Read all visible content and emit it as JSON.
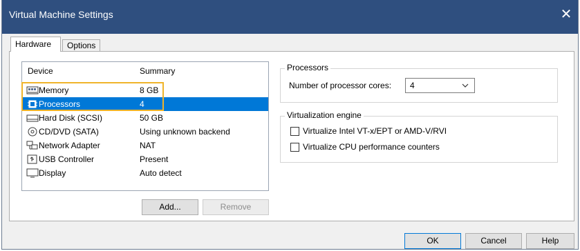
{
  "window": {
    "title": "Virtual Machine Settings",
    "close_glyph": "✕"
  },
  "tabs": [
    {
      "label": "Hardware"
    },
    {
      "label": "Options"
    }
  ],
  "device_list": {
    "headers": {
      "device": "Device",
      "summary": "Summary"
    },
    "rows": [
      {
        "name": "Memory",
        "summary": "8 GB",
        "icon": "memory-icon"
      },
      {
        "name": "Processors",
        "summary": "4",
        "icon": "processor-icon",
        "selected": true
      },
      {
        "name": "Hard Disk (SCSI)",
        "summary": "50 GB",
        "icon": "hard-disk-icon"
      },
      {
        "name": "CD/DVD (SATA)",
        "summary": "Using unknown backend",
        "icon": "cd-dvd-icon"
      },
      {
        "name": "Network Adapter",
        "summary": "NAT",
        "icon": "network-adapter-icon"
      },
      {
        "name": "USB Controller",
        "summary": "Present",
        "icon": "usb-controller-icon"
      },
      {
        "name": "Display",
        "summary": "Auto detect",
        "icon": "display-icon"
      }
    ]
  },
  "list_buttons": {
    "add": "Add...",
    "remove": "Remove"
  },
  "processors_group": {
    "title": "Processors",
    "cores_label": "Number of processor cores:",
    "cores_value": "4"
  },
  "virtualization_group": {
    "title": "Virtualization engine",
    "options": [
      {
        "label": "Virtualize Intel VT-x/EPT or AMD-V/RVI",
        "checked": false
      },
      {
        "label": "Virtualize CPU performance counters",
        "checked": false
      }
    ]
  },
  "footer_buttons": {
    "ok": "OK",
    "cancel": "Cancel",
    "help": "Help"
  },
  "colors": {
    "titlebar": "#2f4f7f",
    "selection": "#0078d7",
    "highlight_box": "#f0b429"
  }
}
